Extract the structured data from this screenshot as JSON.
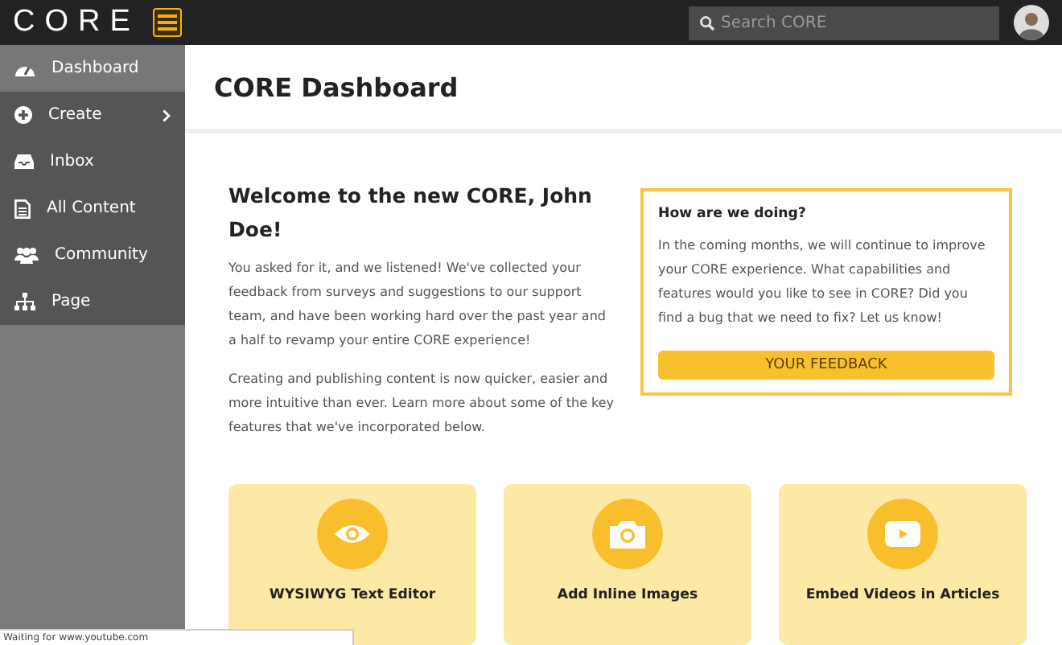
{
  "topbar": {
    "logo": "CORE",
    "search": {
      "placeholder": "Search CORE"
    }
  },
  "sidebar": {
    "items": [
      {
        "label": "Dashboard",
        "kind": "dashboard",
        "selected": true,
        "has_submenu": false
      },
      {
        "label": "Create",
        "kind": "create",
        "selected": false,
        "has_submenu": true
      },
      {
        "label": "Inbox",
        "kind": "inbox",
        "selected": false,
        "has_submenu": false
      },
      {
        "label": "All Content",
        "kind": "content",
        "selected": false,
        "has_submenu": false
      },
      {
        "label": "Community",
        "kind": "community",
        "selected": false,
        "has_submenu": false
      },
      {
        "label": "Page",
        "kind": "page",
        "selected": false,
        "has_submenu": false
      }
    ]
  },
  "page_title": "CORE Dashboard",
  "welcome": {
    "heading": "Welcome to the new CORE, John Doe!",
    "paragraphs": [
      "You asked for it, and we listened! We've collected your feedback from surveys and suggestions to our support team, and have been working hard over the past year and a half to revamp your entire CORE experience!",
      "Creating and publishing content is now quicker, easier and more intuitive than ever. Learn more about some of the key features that we've incorporated below."
    ]
  },
  "feedback": {
    "heading": "How are we doing?",
    "text": "In the coming months, we will continue to improve your CORE experience. What capabilities and features would you like to see in CORE? Did you find a bug that we need to fix? Let us know!",
    "button": "YOUR FEEDBACK"
  },
  "features": [
    {
      "label": "WYSIWYG Text Editor",
      "kind": "editor"
    },
    {
      "label": "Add Inline Images",
      "kind": "images"
    },
    {
      "label": "Embed Videos in Articles",
      "kind": "videos"
    }
  ],
  "status_bar": "Waiting for www.youtube.com"
}
